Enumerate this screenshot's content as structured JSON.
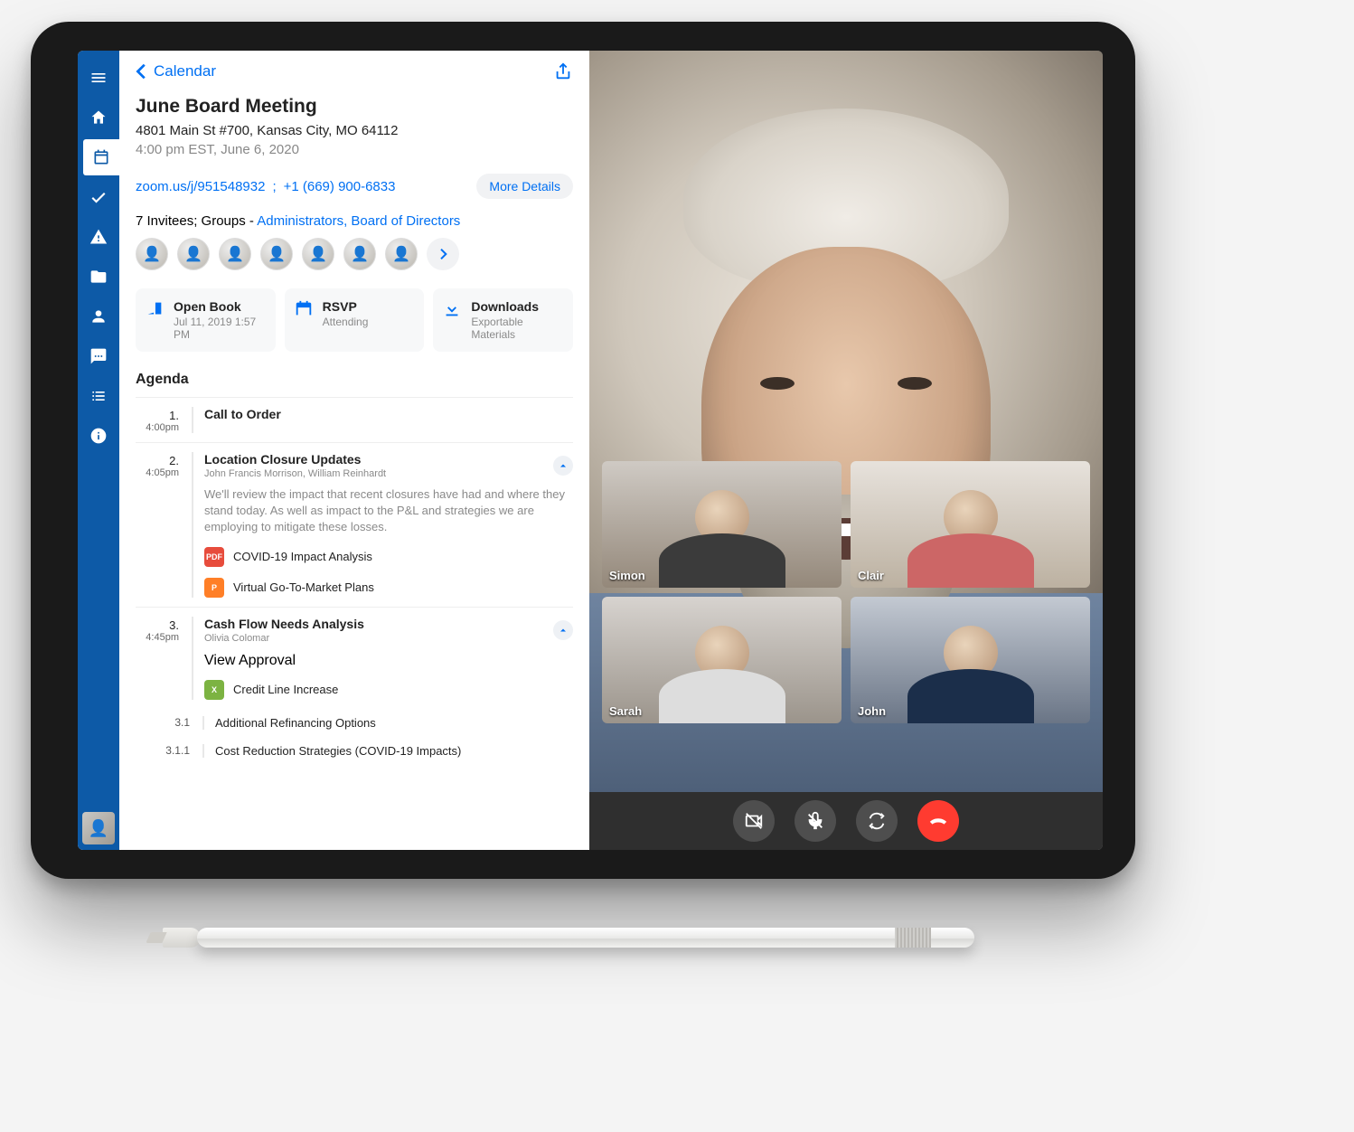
{
  "nav": {
    "back_label": "Calendar"
  },
  "meeting": {
    "title": "June Board Meeting",
    "address": "4801 Main St #700, Kansas City, MO 64112",
    "when": "4:00 pm EST,  June 6, 2020",
    "zoom_link": "zoom.us/j/951548932",
    "sep": "; ",
    "dial": "+1 (669) 900-6833",
    "more_details": "More Details",
    "invitees_prefix": "7 Invitees; Groups - ",
    "groups": "Administrators, Board of Directors"
  },
  "cards": {
    "open_book": {
      "title": "Open Book",
      "sub": "Jul 11, 2019 1:57 PM"
    },
    "rsvp": {
      "title": "RSVP",
      "sub": "Attending"
    },
    "downloads": {
      "title": "Downloads",
      "sub": "Exportable Materials"
    }
  },
  "agenda_heading": "Agenda",
  "agenda": [
    {
      "num": "1.",
      "time": "4:00pm",
      "title": "Call to Order"
    },
    {
      "num": "2.",
      "time": "4:05pm",
      "title": "Location Closure Updates",
      "presenters": "John Francis Morrison, William Reinhardt",
      "desc": "We'll review the impact that recent closures have had and where they stand today. As well as impact to the P&L and strategies we are employing to mitigate these losses.",
      "attachments": [
        {
          "kind": "PDF",
          "name": "COVID-19 Impact Analysis"
        },
        {
          "kind": "P",
          "name": "Virtual Go-To-Market Plans"
        }
      ]
    },
    {
      "num": "3.",
      "time": "4:45pm",
      "title": "Cash Flow Needs Analysis",
      "presenters": "Olivia Colomar",
      "action_link": "View Approval",
      "attachments": [
        {
          "kind": "X",
          "name": "Credit Line Increase"
        }
      ],
      "subitems": [
        {
          "num": "3.1",
          "title": "Additional Refinancing Options"
        },
        {
          "num": "3.1.1",
          "title": "Cost Reduction Strategies (COVID-19 Impacts)"
        }
      ]
    }
  ],
  "video": {
    "participants": [
      {
        "name": "Simon"
      },
      {
        "name": "Clair"
      },
      {
        "name": "Sarah"
      },
      {
        "name": "John"
      }
    ]
  }
}
